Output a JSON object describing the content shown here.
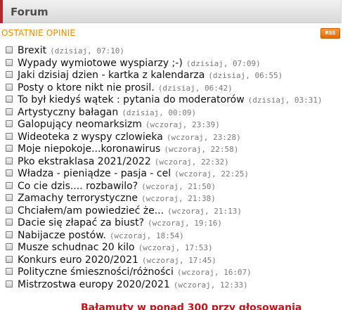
{
  "header": {
    "title": "Forum"
  },
  "section": {
    "title": "OSTATNIE OPINIE",
    "rss_label": "RSS"
  },
  "threads": [
    {
      "title": "Brexit",
      "time": "(dzisiaj, 07:10)"
    },
    {
      "title": "Wypady wymiotowe wyspiarzy ;-)",
      "time": "(dzisiaj, 07:09)"
    },
    {
      "title": "Jaki dzisiaj dzien - kartka z kalendarza",
      "time": "(dzisiaj, 06:55)"
    },
    {
      "title": "Posty o ktore nikt nie prosil.",
      "time": "(dzisiaj, 06:42)"
    },
    {
      "title": "To był kiedyś wątek : pytania do moderatorów",
      "time": "(dzisiaj, 03:31)"
    },
    {
      "title": "Artystyczny bałagan",
      "time": "(dzisiaj, 00:09)"
    },
    {
      "title": "Galopujący neomarksizm",
      "time": "(wczoraj, 23:39)"
    },
    {
      "title": "Wideoteka z wyspy czlowieka",
      "time": "(wczoraj, 23:28)"
    },
    {
      "title": "Moje niepokoje...koronawirus",
      "time": "(wczoraj, 22:58)"
    },
    {
      "title": "Pko ekstraklasa 2021/2022",
      "time": "(wczoraj, 22:32)"
    },
    {
      "title": "Władza - pieniądze - pasja - cel",
      "time": "(wczoraj, 22:25)"
    },
    {
      "title": "Co cie dzis.... rozbawilo?",
      "time": "(wczoraj, 21:50)"
    },
    {
      "title": "Zamachy terrorystyczne",
      "time": "(wczoraj, 21:38)"
    },
    {
      "title": "Chciałem/am powiedzieć że...",
      "time": "(wczoraj, 21:13)"
    },
    {
      "title": "Dacie się złapać za biust?",
      "time": "(wczoraj, 19:16)"
    },
    {
      "title": "Nabijacze postów.",
      "time": "(wczoraj, 18:54)"
    },
    {
      "title": "Musze schudnac 20 kilo",
      "time": "(wczoraj, 17:53)"
    },
    {
      "title": "Konkurs euro 2020/2021",
      "time": "(wczoraj, 17:45)"
    },
    {
      "title": "Polityczne śmieszności/różności",
      "time": "(wczoraj, 16:07)"
    },
    {
      "title": "Mistrzostwa europy 2020/2021",
      "time": "(wczoraj, 12:33)"
    }
  ],
  "footer": {
    "link_text": "Bałamuty w ponad 300 przy głosowania"
  }
}
